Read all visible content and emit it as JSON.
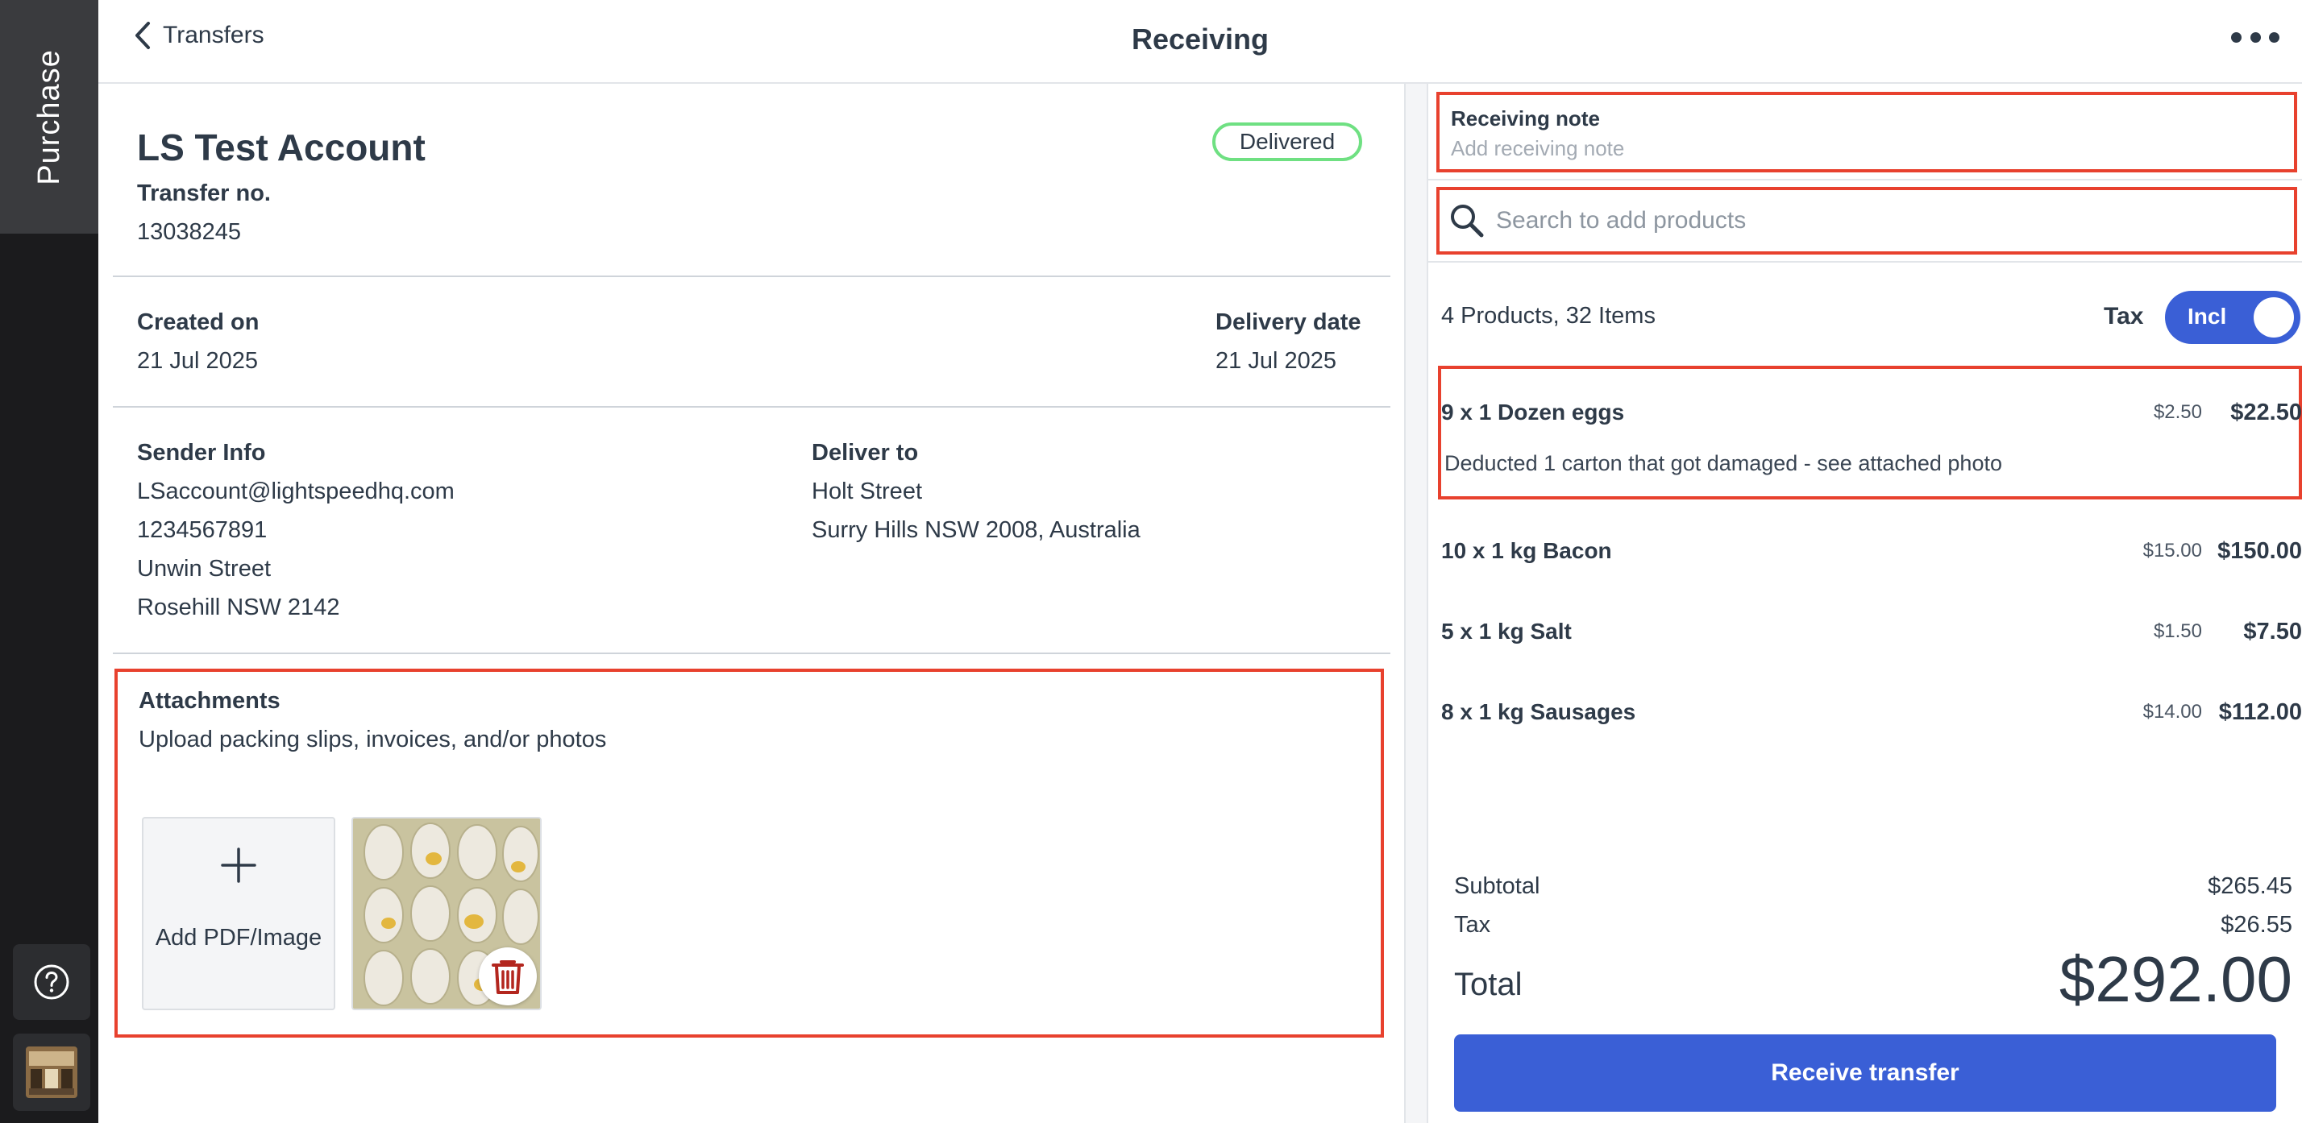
{
  "rail": {
    "tab_label": "Purchase",
    "help_icon": "question-circle-icon",
    "thumbnail_icon": "store-thumbnail-icon"
  },
  "header": {
    "back_label": "Transfers",
    "title": "Receiving",
    "more_icon": "more-horizontal-icon"
  },
  "transfer": {
    "account_name": "LS Test Account",
    "status": "Delivered",
    "transfer_no_label": "Transfer no.",
    "transfer_no": "13038245",
    "created_label": "Created on",
    "created_value": "21 Jul 2025",
    "delivery_label": "Delivery date",
    "delivery_value": "21 Jul 2025"
  },
  "sender": {
    "label": "Sender Info",
    "lines": [
      "LSaccount@lightspeedhq.com",
      "1234567891",
      "Unwin Street",
      "Rosehill NSW 2142"
    ]
  },
  "deliver_to": {
    "label": "Deliver to",
    "lines": [
      "Holt Street",
      "Surry Hills NSW 2008, Australia"
    ]
  },
  "attachments": {
    "label": "Attachments",
    "description": "Upload packing slips, invoices, and/or photos",
    "add_label": "Add PDF/Image",
    "add_icon": "plus-icon",
    "delete_icon": "trash-icon"
  },
  "receiving_note": {
    "label": "Receiving note",
    "placeholder": "Add receiving note"
  },
  "search": {
    "placeholder": "Search to add products",
    "icon": "search-icon"
  },
  "summary": {
    "text": "4 Products, 32 Items",
    "tax_label": "Tax",
    "tax_toggle_label": "Incl"
  },
  "items": [
    {
      "name": "9 x 1 Dozen eggs",
      "unit_price": "$2.50",
      "total": "$22.50",
      "note": "Deducted 1 carton that got damaged - see attached photo"
    },
    {
      "name": "10 x 1 kg Bacon",
      "unit_price": "$15.00",
      "total": "$150.00"
    },
    {
      "name": "5 x 1 kg Salt",
      "unit_price": "$1.50",
      "total": "$7.50"
    },
    {
      "name": "8 x 1 kg Sausages",
      "unit_price": "$14.00",
      "total": "$112.00"
    }
  ],
  "totals": {
    "subtotal_label": "Subtotal",
    "subtotal": "$265.45",
    "tax_label": "Tax",
    "tax": "$26.55",
    "total_label": "Total",
    "total": "$292.00"
  },
  "receive_button": "Receive transfer",
  "colors": {
    "accent": "#3a5fd6",
    "highlight": "#e8412e",
    "status_border": "#6fe082"
  }
}
